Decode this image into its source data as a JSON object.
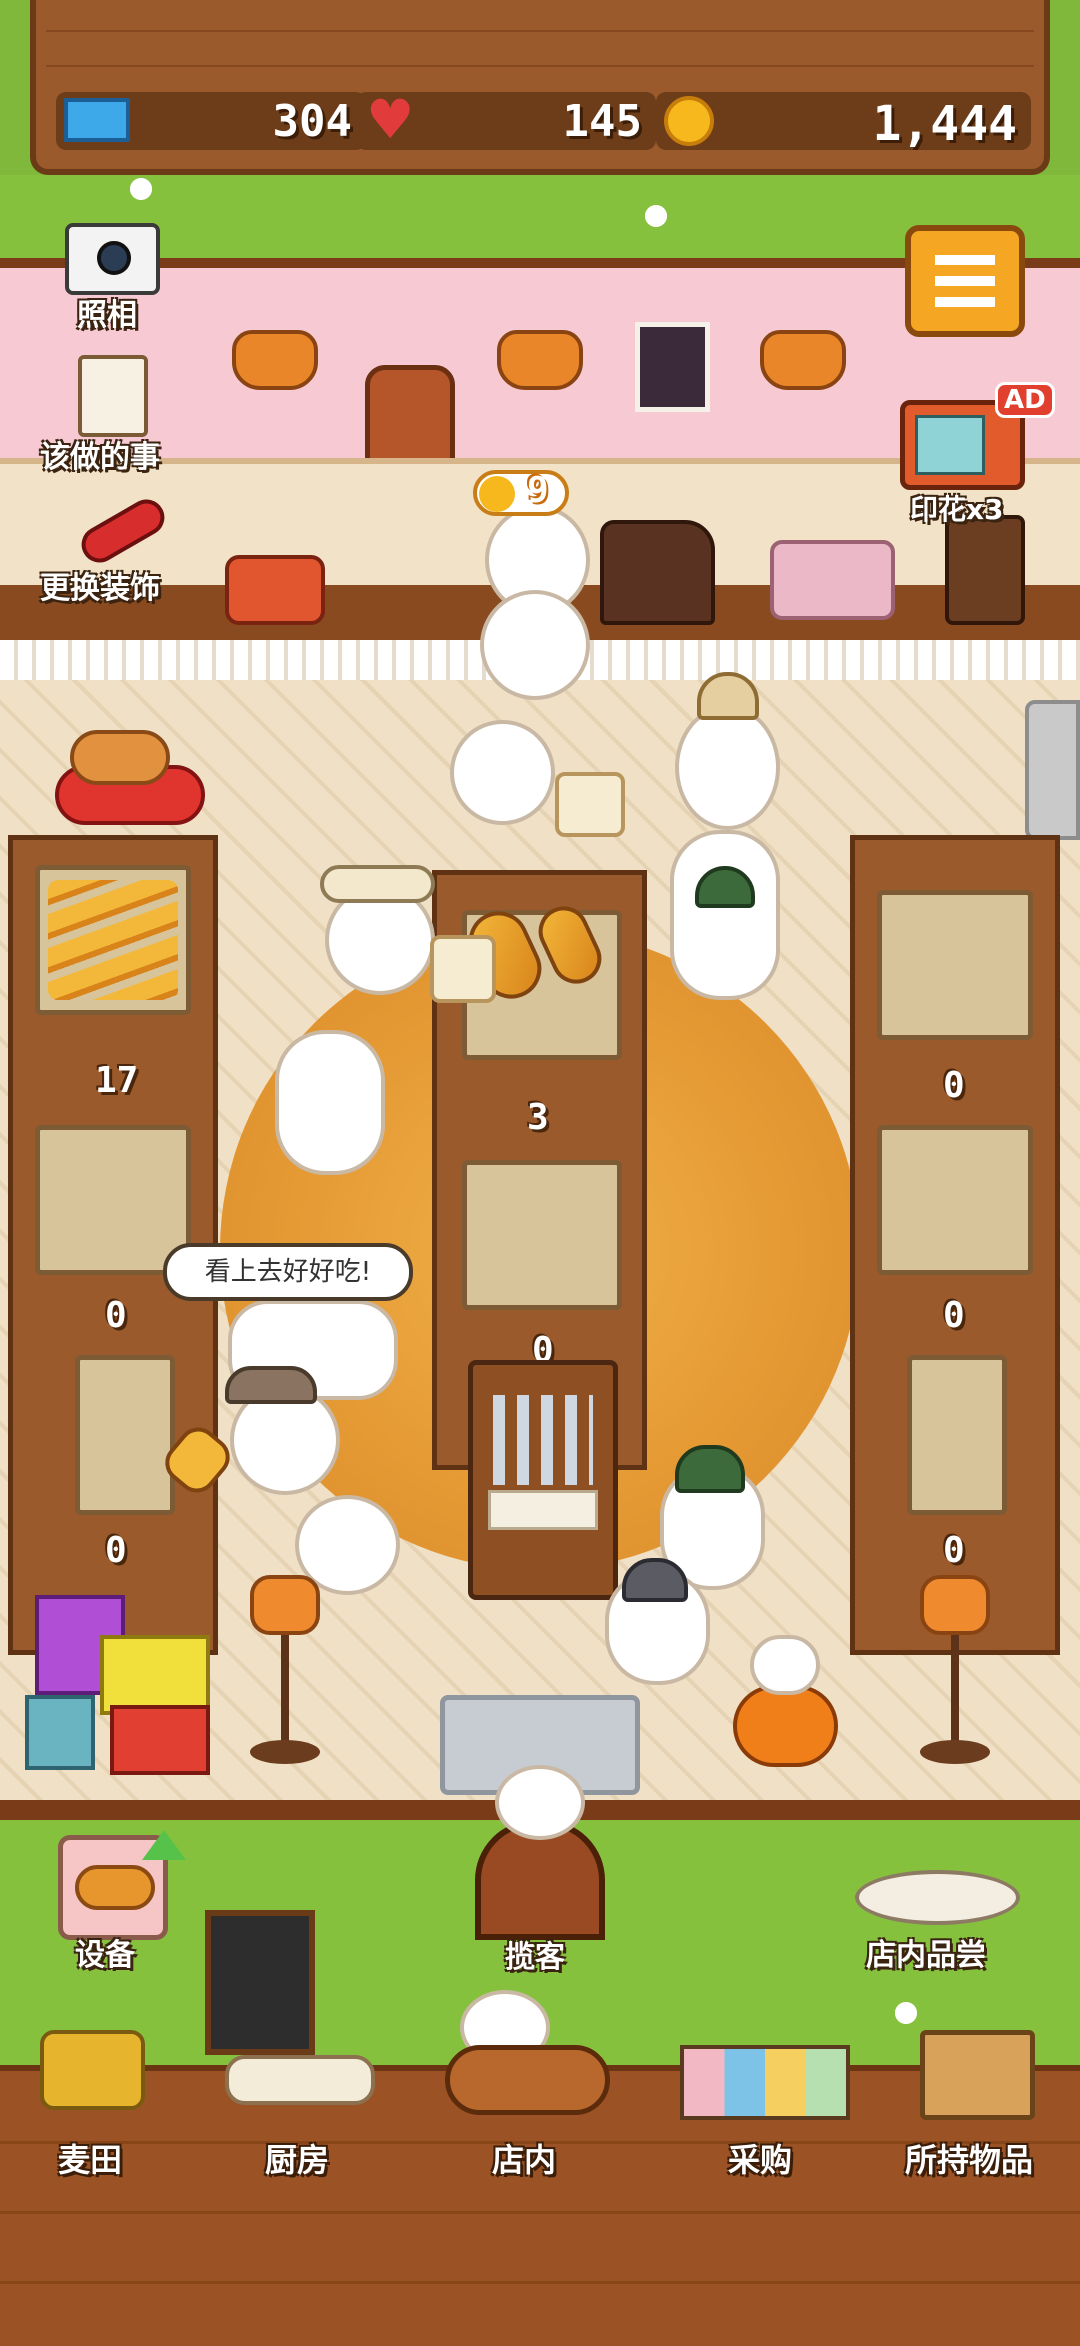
{
  "resources": {
    "tickets": "304",
    "hearts": "145",
    "coins": "1,444"
  },
  "side_buttons": {
    "photo": "照相",
    "todo": "该做的事",
    "decorate": "更换装饰",
    "stamp_ad": "印花x3",
    "ad_badge": "AD"
  },
  "order_bubble": {
    "value": "9"
  },
  "shelf_counts": {
    "left_top": "17",
    "left_mid": "0",
    "left_bottom": "0",
    "center_top": "3",
    "center_mid": "0",
    "right_top": "0",
    "right_mid": "0",
    "right_bottom": "0"
  },
  "speech": "看上去好好吃!",
  "bottom_actions": {
    "equipment": "设备",
    "attract": "揽客",
    "tasting": "店内品尝"
  },
  "nav": {
    "wheat_field": "麦田",
    "kitchen": "厨房",
    "store": "店内",
    "purchase": "采购",
    "inventory": "所持物品"
  },
  "colors": {
    "wood": "#9b5224",
    "grass": "#86c13e",
    "wall_pink": "#f6c9d3",
    "menu_orange": "#f5a623"
  }
}
